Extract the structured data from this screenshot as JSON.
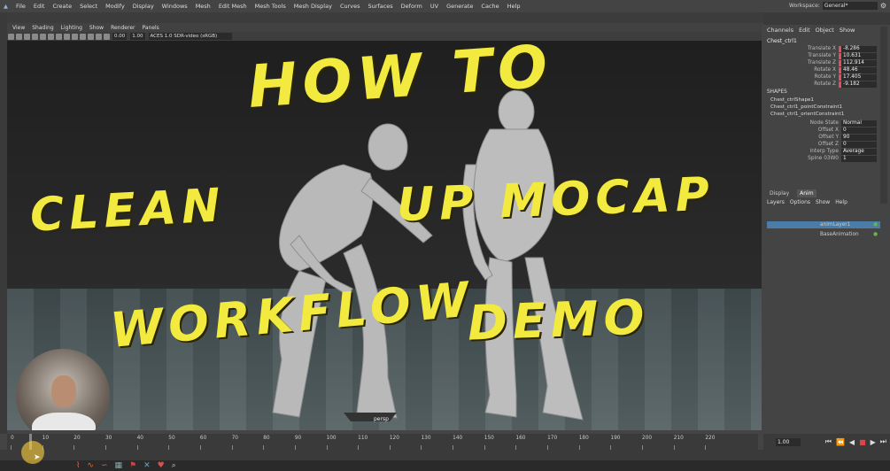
{
  "menubar": {
    "items": [
      "File",
      "Edit",
      "Create",
      "Select",
      "Modify",
      "Display",
      "Windows",
      "Mesh",
      "Edit Mesh",
      "Mesh Tools",
      "Mesh Display",
      "Curves",
      "Surfaces",
      "Deform",
      "UV",
      "Generate",
      "Cache",
      "Help"
    ],
    "workspace_label": "Workspace:",
    "workspace_value": "General*"
  },
  "viewport": {
    "menu": [
      "View",
      "Shading",
      "Lighting",
      "Show",
      "Renderer",
      "Panels"
    ],
    "field_a": "0.00",
    "field_b": "1.00",
    "colorspace": "ACES 1.0 SDR-video (sRGB)",
    "camera": "persp"
  },
  "overlay_text": {
    "line1": "HOW TO",
    "line2a": "CLEAN",
    "line2b": "UP MOCAP",
    "line3a": "WORKFLOW",
    "line3b": "DEMO"
  },
  "channel_box": {
    "tabs": [
      "Channels",
      "Edit",
      "Object",
      "Show"
    ],
    "node": "Chest_ctrl1",
    "attributes": [
      {
        "label": "Translate X",
        "value": "-8.286"
      },
      {
        "label": "Translate Y",
        "value": "10.631"
      },
      {
        "label": "Translate Z",
        "value": "112.914"
      },
      {
        "label": "Rotate X",
        "value": "48.46"
      },
      {
        "label": "Rotate Y",
        "value": "17.405"
      },
      {
        "label": "Rotate Z",
        "value": "-9.182"
      }
    ],
    "shapes_title": "SHAPES",
    "shapes": [
      "Chest_ctrlShape1",
      "Chest_ctrl1_pointConstraint1",
      "Chest_ctrl1_orientConstraint1"
    ],
    "node_attrs": [
      {
        "label": "Node State",
        "value": "Normal"
      },
      {
        "label": "Offset X",
        "value": "0"
      },
      {
        "label": "Offset Y",
        "value": "90"
      },
      {
        "label": "Offset Z",
        "value": "0"
      },
      {
        "label": "Interp Type",
        "value": "Average"
      },
      {
        "label": "Spine 03W0",
        "value": "1"
      }
    ]
  },
  "layer_editor": {
    "tabs": [
      "Display",
      "Anim"
    ],
    "active_tab": "Anim",
    "menu": [
      "Layers",
      "Options",
      "Show",
      "Help"
    ],
    "layers": [
      "animLayer1",
      "BaseAnimation"
    ]
  },
  "timeline": {
    "ticks": [
      "0",
      "10",
      "20",
      "30",
      "40",
      "50",
      "60",
      "70",
      "80",
      "90",
      "100",
      "110",
      "120",
      "130",
      "140",
      "150",
      "160",
      "170",
      "180",
      "190",
      "200",
      "210",
      "220"
    ],
    "current_frame": "1.00"
  },
  "colors": {
    "overlay": "#f3ea3f",
    "keyed": "#d8525f",
    "layer_highlight": "#4b7ca8",
    "accent_green": "#5fb84a"
  }
}
